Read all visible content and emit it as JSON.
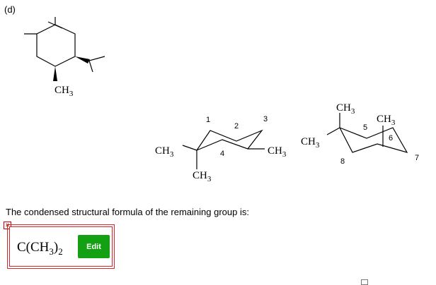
{
  "question": {
    "part_label": "(d)",
    "prompt": "The condensed structural formula of the remaining group is:"
  },
  "structure_labels": {
    "top_methyl": "CH3",
    "left_chair_methyl_left": "CH3",
    "left_chair_methyl_right": "CH3",
    "left_chair_methyl_bottom": "CH3",
    "left_chair_numbers": [
      "1",
      "2",
      "3",
      "4"
    ],
    "right_chair_methyl_top": "CH3",
    "right_chair_methyl_left": "CH3",
    "right_chair_methyl_right": "CH3",
    "right_chair_numbers": [
      "5",
      "6",
      "7",
      "8"
    ]
  },
  "answer": {
    "formula_main": "C(CH",
    "formula_sub_inner": "3",
    "formula_close": ")",
    "formula_sub_outer": "2",
    "edit_label": "Edit",
    "status": "incorrect"
  },
  "colors": {
    "edit_button": "#13a013",
    "error_border": "#d9262b"
  }
}
